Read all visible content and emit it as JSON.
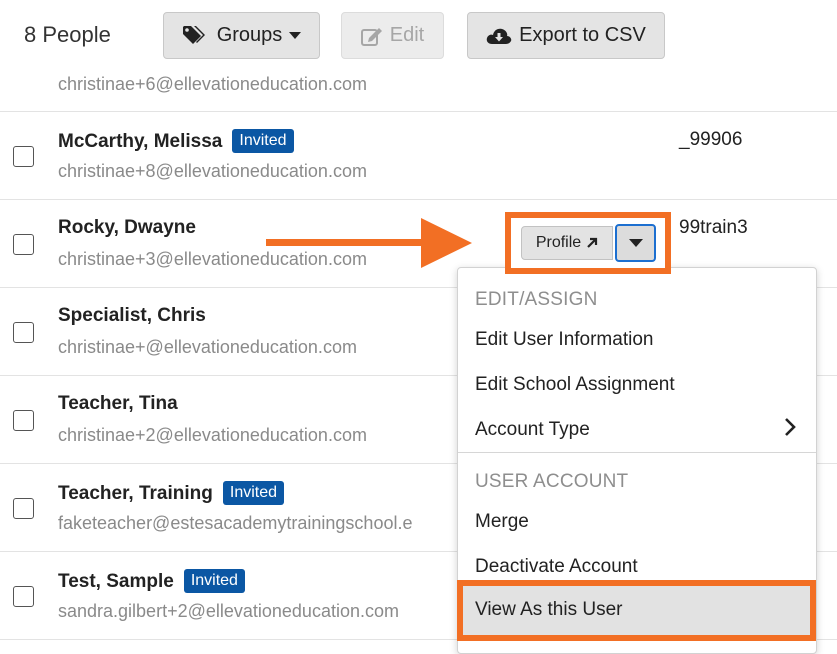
{
  "toolbar": {
    "count_label": "8 People",
    "groups_label": "Groups",
    "edit_label": "Edit",
    "export_label": "Export to CSV"
  },
  "rows": [
    {
      "name": "",
      "email": "christinae+6@ellevationeducation.com",
      "badge": "",
      "uid": ""
    },
    {
      "name": "McCarthy, Melissa",
      "email": "christinae+8@ellevationeducation.com",
      "badge": "Invited",
      "uid": "_99906"
    },
    {
      "name": "Rocky, Dwayne",
      "email": "christinae+3@ellevationeducation.com",
      "badge": "",
      "uid": "99train3"
    },
    {
      "name": "Specialist, Chris",
      "email": "christinae+@ellevationeducation.com",
      "badge": "",
      "uid": ""
    },
    {
      "name": "Teacher, Tina",
      "email": "christinae+2@ellevationeducation.com",
      "badge": "",
      "uid": ""
    },
    {
      "name": "Teacher, Training",
      "email": "faketeacher@estesacademytrainingschool.e",
      "badge": "Invited",
      "uid": ""
    },
    {
      "name": "Test, Sample",
      "email": "sandra.gilbert+2@ellevationeducation.com",
      "badge": "Invited",
      "uid": ""
    }
  ],
  "actions": {
    "profile_label": "Profile"
  },
  "menu": {
    "section_edit": "EDIT/ASSIGN",
    "edit_user_info": "Edit User Information",
    "edit_school_assignment": "Edit School Assignment",
    "account_type": "Account Type",
    "section_account": "USER ACCOUNT",
    "merge": "Merge",
    "deactivate": "Deactivate Account",
    "view_as_user": "View As this User"
  },
  "colors": {
    "accent_orange": "#f26f24",
    "badge_blue": "#0b57a4",
    "focus_blue": "#1c6fd0"
  },
  "icons": {
    "groups": "tags-icon",
    "edit": "edit-icon",
    "export": "cloud-download-icon",
    "profile": "external-arrow-icon",
    "caret": "caret-down-icon",
    "submenu": "chevron-right-icon",
    "annotation": "orange-arrow-icon"
  }
}
